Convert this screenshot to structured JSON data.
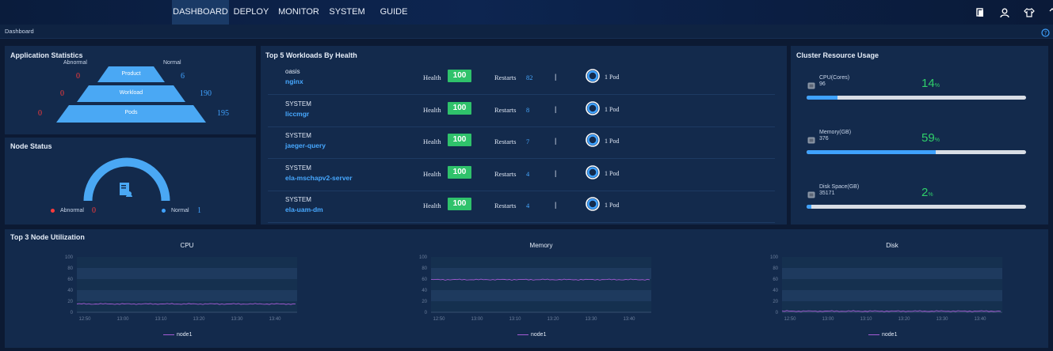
{
  "nav": {
    "tabs": [
      {
        "label": "DASHBOARD",
        "active": true
      },
      {
        "label": "DEPLOY",
        "active": false
      },
      {
        "label": "MONITOR",
        "active": false
      },
      {
        "label": "SYSTEM",
        "active": false
      },
      {
        "label": "GUIDE",
        "active": false
      }
    ],
    "icons": [
      "document-icon",
      "user-icon",
      "shirt-icon",
      "chevron-icon"
    ]
  },
  "breadcrumb": "Dashboard",
  "app_stats": {
    "title": "Application Statistics",
    "abnormal_label": "Abnormal",
    "normal_label": "Normal",
    "rows": [
      {
        "label": "Product",
        "abnormal": "0",
        "normal": "6"
      },
      {
        "label": "Workload",
        "abnormal": "0",
        "normal": "190"
      },
      {
        "label": "Pods",
        "abnormal": "0",
        "normal": "195"
      }
    ]
  },
  "node_status": {
    "title": "Node Status",
    "abnormal_label": "Abnormal",
    "abnormal_value": "0",
    "normal_label": "Normal",
    "normal_value": "1"
  },
  "workloads": {
    "title": "Top 5 Workloads By Health",
    "health_label": "Health",
    "restarts_label": "Restarts",
    "separator": "|",
    "items": [
      {
        "namespace": "oasis",
        "name": "nginx",
        "health": "100",
        "restarts": "82",
        "pods": "1 Pod"
      },
      {
        "namespace": "SYSTEM",
        "name": "liccmgr",
        "health": "100",
        "restarts": "8",
        "pods": "1 Pod"
      },
      {
        "namespace": "SYSTEM",
        "name": "jaeger-query",
        "health": "100",
        "restarts": "7",
        "pods": "1 Pod"
      },
      {
        "namespace": "SYSTEM",
        "name": "ela-mschapv2-server",
        "health": "100",
        "restarts": "4",
        "pods": "1 Pod"
      },
      {
        "namespace": "SYSTEM",
        "name": "ela-uam-dm",
        "health": "100",
        "restarts": "4",
        "pods": "1 Pod"
      }
    ]
  },
  "cluster": {
    "title": "Cluster Resource Usage",
    "resources": [
      {
        "label": "CPU(Cores)",
        "value": "96",
        "percent": "14",
        "unit": "%",
        "fraction": 0.14
      },
      {
        "label": "Memory(GB)",
        "value": "376",
        "percent": "59",
        "unit": "%",
        "fraction": 0.59
      },
      {
        "label": "Disk Space(GB)",
        "value": "35171",
        "percent": "2",
        "unit": "%",
        "fraction": 0.02
      }
    ]
  },
  "utilization": {
    "title": "Top 3 Node Utilization"
  },
  "chart_data": [
    {
      "type": "line",
      "title": "CPU",
      "x": [
        "12:50",
        "13:00",
        "13:10",
        "13:20",
        "13:30",
        "13:40"
      ],
      "ylim": [
        0,
        100
      ],
      "yticks": [
        "0",
        "20",
        "40",
        "60",
        "80",
        "100"
      ],
      "series": [
        {
          "name": "node1",
          "level": 15
        }
      ],
      "grid": true,
      "legend": "bottom"
    },
    {
      "type": "line",
      "title": "Memory",
      "x": [
        "12:50",
        "13:00",
        "13:10",
        "13:20",
        "13:30",
        "13:40"
      ],
      "ylim": [
        0,
        100
      ],
      "yticks": [
        "0",
        "20",
        "40",
        "60",
        "80",
        "100"
      ],
      "series": [
        {
          "name": "node1",
          "level": 59
        }
      ],
      "grid": true,
      "legend": "bottom"
    },
    {
      "type": "line",
      "title": "Disk",
      "x": [
        "12:50",
        "13:00",
        "13:10",
        "13:20",
        "13:30",
        "13:40"
      ],
      "ylim": [
        0,
        100
      ],
      "yticks": [
        "0",
        "20",
        "40",
        "60",
        "80",
        "100"
      ],
      "series": [
        {
          "name": "node1",
          "level": 2
        }
      ],
      "grid": true,
      "legend": "bottom"
    }
  ],
  "colors": {
    "accent": "#3fa2ff",
    "healthy": "#2fc26b",
    "abnormal": "#ff3b3b",
    "series": "#a55cd6"
  }
}
